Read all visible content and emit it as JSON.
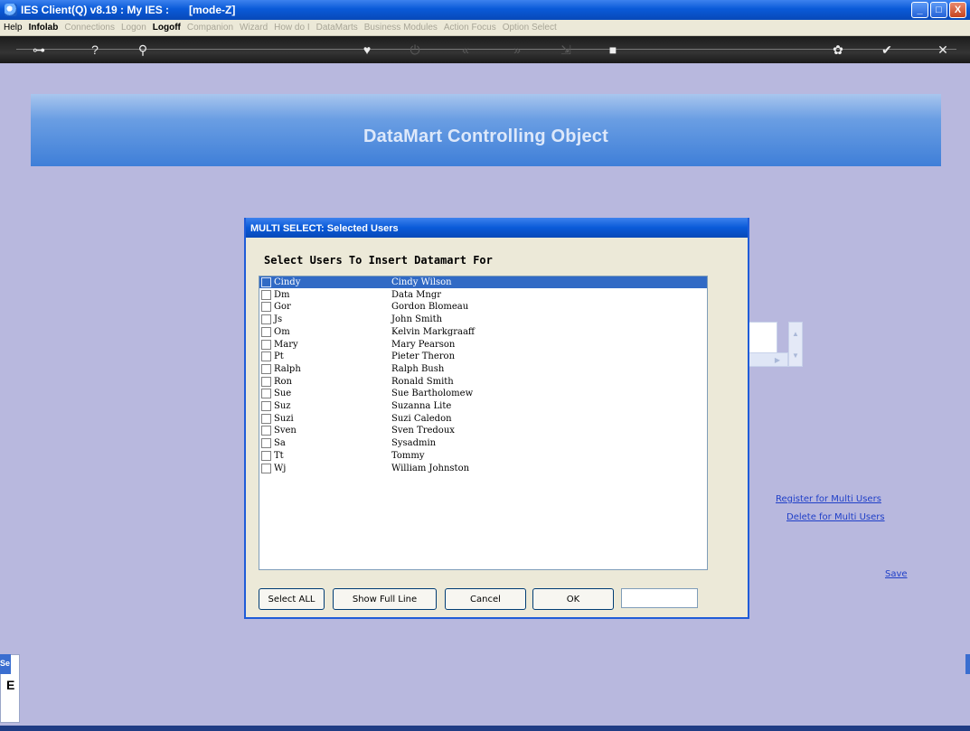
{
  "window": {
    "title": "IES Client(Q) v8.19 : My IES :",
    "mode": "[mode-Z]",
    "buttons": [
      "_",
      "□",
      "X"
    ]
  },
  "menu": {
    "items": [
      {
        "label": "Help",
        "enabled": true
      },
      {
        "label": "Infolab",
        "enabled": true
      },
      {
        "label": "Connections",
        "enabled": false
      },
      {
        "label": "Logon",
        "enabled": false
      },
      {
        "label": "Logoff",
        "enabled": true
      },
      {
        "label": "Companion",
        "enabled": false
      },
      {
        "label": "Wizard",
        "enabled": false
      },
      {
        "label": "How do I",
        "enabled": false
      },
      {
        "label": "DataMarts",
        "enabled": false
      },
      {
        "label": "Business Modules",
        "enabled": false
      },
      {
        "label": "Action Focus",
        "enabled": false
      },
      {
        "label": "Option Select",
        "enabled": false
      }
    ]
  },
  "toolbar": {
    "icons": [
      {
        "name": "key-icon",
        "glyph": "⊶",
        "dim": false
      },
      {
        "name": "help-icon",
        "glyph": "?",
        "dim": false
      },
      {
        "name": "search-icon",
        "glyph": "⚲",
        "dim": false
      },
      {
        "name": "heart-icon",
        "glyph": "♥",
        "dim": false
      },
      {
        "name": "power-icon",
        "glyph": "⏻",
        "dim": true
      },
      {
        "name": "rewind-icon",
        "glyph": "«",
        "dim": true
      },
      {
        "name": "forward-icon",
        "glyph": "»",
        "dim": true
      },
      {
        "name": "export-icon",
        "glyph": "⇲",
        "dim": true
      },
      {
        "name": "stop-icon",
        "glyph": "■",
        "dim": false
      },
      {
        "name": "settings-icon",
        "glyph": "✿",
        "dim": false
      },
      {
        "name": "check-icon",
        "glyph": "✔",
        "dim": false
      },
      {
        "name": "close-icon",
        "glyph": "✕",
        "dim": false
      }
    ]
  },
  "banner": {
    "title": "DataMart Controlling Object"
  },
  "links": {
    "register": "Register for Multi Users",
    "delete": "Delete for Multi Users",
    "save": "Save"
  },
  "sidebar": {
    "tab": "Se",
    "char": "E"
  },
  "dialog": {
    "title": "MULTI SELECT: Selected Users",
    "heading": "Select Users To Insert Datamart For",
    "users": [
      {
        "id": "Cindy",
        "name": "Cindy Wilson",
        "selected": true
      },
      {
        "id": "Dm",
        "name": "Data Mngr",
        "selected": false
      },
      {
        "id": "Gor",
        "name": "Gordon Blomeau",
        "selected": false
      },
      {
        "id": "Js",
        "name": "John Smith",
        "selected": false
      },
      {
        "id": "Om",
        "name": "Kelvin Markgraaff",
        "selected": false
      },
      {
        "id": "Mary",
        "name": "Mary Pearson",
        "selected": false
      },
      {
        "id": "Pt",
        "name": "Pieter Theron",
        "selected": false
      },
      {
        "id": "Ralph",
        "name": "Ralph Bush",
        "selected": false
      },
      {
        "id": "Ron",
        "name": "Ronald Smith",
        "selected": false
      },
      {
        "id": "Sue",
        "name": "Sue Bartholomew",
        "selected": false
      },
      {
        "id": "Suz",
        "name": "Suzanna Lite",
        "selected": false
      },
      {
        "id": "Suzi",
        "name": "Suzi Caledon",
        "selected": false
      },
      {
        "id": "Sven",
        "name": "Sven Tredoux",
        "selected": false
      },
      {
        "id": "Sa",
        "name": "Sysadmin",
        "selected": false
      },
      {
        "id": "Tt",
        "name": "Tommy",
        "selected": false
      },
      {
        "id": "Wj",
        "name": "William Johnston",
        "selected": false
      }
    ],
    "buttons": {
      "select_all": "Select ALL",
      "show_full_line": "Show Full Line",
      "cancel": "Cancel",
      "ok": "OK"
    },
    "ok_field_value": ""
  }
}
